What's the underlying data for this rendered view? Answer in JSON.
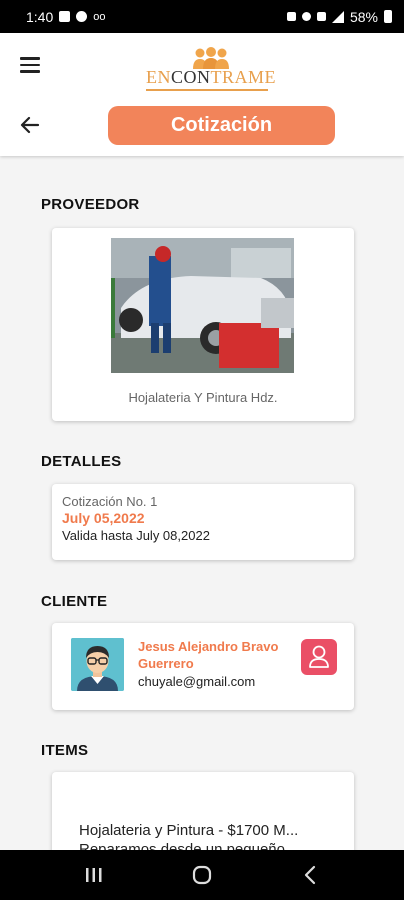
{
  "status_bar": {
    "time": "1:40",
    "battery": "58%",
    "icons": [
      "image-icon",
      "whatsapp-icon",
      "voicemail-icon",
      "mute-icon",
      "alarm-icon",
      "wifi-icon",
      "signal-icon",
      "battery-icon"
    ]
  },
  "header": {
    "logo_text_left": "EN",
    "logo_text_mid": "CON",
    "logo_text_right": "TRAME",
    "title": "Cotización",
    "accent_color": "#f2845a"
  },
  "provider": {
    "section_title": "PROVEEDOR",
    "name": "Hojalateria Y Pintura Hdz."
  },
  "details": {
    "section_title": "DETALLES",
    "quote_number": "Cotización No. 1",
    "date": "July 05,2022",
    "valid_until": "Valida hasta July 08,2022"
  },
  "client": {
    "section_title": "CLIENTE",
    "name": "Jesus Alejandro Bravo Guerrero",
    "email": "chuyale@gmail.com"
  },
  "items": {
    "section_title": "ITEMS",
    "item_line1": "Hojalateria y Pintura - $1700 M...",
    "item_line2": "Reparamos desde un pequeño..."
  },
  "colors": {
    "accent": "#f2845a",
    "orange_text": "#f07a4c",
    "client_button": "#ea4f66"
  }
}
